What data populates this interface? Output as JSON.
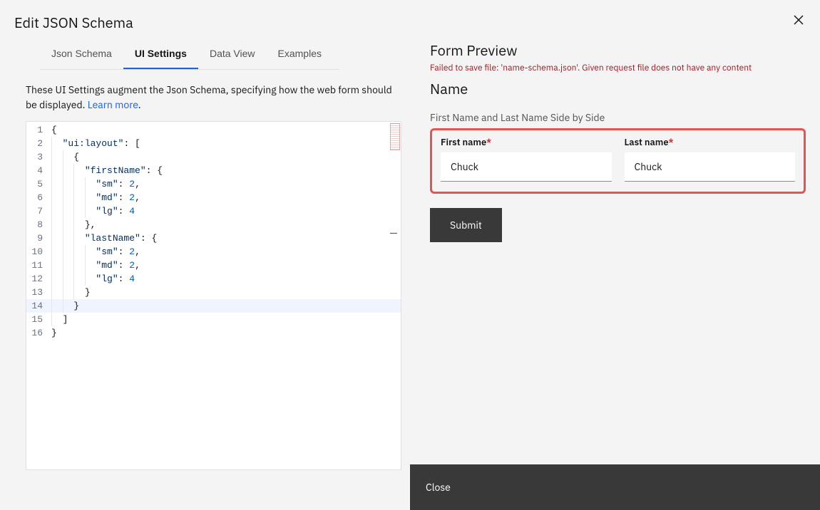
{
  "modal": {
    "title": "Edit JSON Schema",
    "close_bar_label": "Close"
  },
  "tabs": [
    {
      "label": "Json Schema",
      "active": false
    },
    {
      "label": "UI Settings",
      "active": true
    },
    {
      "label": "Data View",
      "active": false
    },
    {
      "label": "Examples",
      "active": false
    }
  ],
  "intro": {
    "text_before_link": "These UI Settings augment the Json Schema, specifying how the web form should be displayed. ",
    "link_text": "Learn more",
    "text_after_link": "."
  },
  "code_lines": [
    {
      "n": 1,
      "indent": 0,
      "tokens": [
        {
          "c": "brace",
          "t": "{"
        }
      ]
    },
    {
      "n": 2,
      "indent": 1,
      "tokens": [
        {
          "c": "key",
          "t": "\"ui:layout\""
        },
        {
          "c": "punct",
          "t": ": "
        },
        {
          "c": "bracket",
          "t": "["
        }
      ]
    },
    {
      "n": 3,
      "indent": 2,
      "tokens": [
        {
          "c": "brace",
          "t": "{"
        }
      ]
    },
    {
      "n": 4,
      "indent": 3,
      "tokens": [
        {
          "c": "key",
          "t": "\"firstName\""
        },
        {
          "c": "punct",
          "t": ": "
        },
        {
          "c": "brace",
          "t": "{"
        }
      ]
    },
    {
      "n": 5,
      "indent": 4,
      "tokens": [
        {
          "c": "key",
          "t": "\"sm\""
        },
        {
          "c": "punct",
          "t": ": "
        },
        {
          "c": "num",
          "t": "2"
        },
        {
          "c": "punct",
          "t": ","
        }
      ]
    },
    {
      "n": 6,
      "indent": 4,
      "tokens": [
        {
          "c": "key",
          "t": "\"md\""
        },
        {
          "c": "punct",
          "t": ": "
        },
        {
          "c": "num",
          "t": "2"
        },
        {
          "c": "punct",
          "t": ","
        }
      ]
    },
    {
      "n": 7,
      "indent": 4,
      "tokens": [
        {
          "c": "key",
          "t": "\"lg\""
        },
        {
          "c": "punct",
          "t": ": "
        },
        {
          "c": "num",
          "t": "4"
        }
      ]
    },
    {
      "n": 8,
      "indent": 3,
      "tokens": [
        {
          "c": "brace",
          "t": "}"
        },
        {
          "c": "punct",
          "t": ","
        }
      ]
    },
    {
      "n": 9,
      "indent": 3,
      "tokens": [
        {
          "c": "key",
          "t": "\"lastName\""
        },
        {
          "c": "punct",
          "t": ": "
        },
        {
          "c": "brace",
          "t": "{"
        }
      ]
    },
    {
      "n": 10,
      "indent": 4,
      "tokens": [
        {
          "c": "key",
          "t": "\"sm\""
        },
        {
          "c": "punct",
          "t": ": "
        },
        {
          "c": "num",
          "t": "2"
        },
        {
          "c": "punct",
          "t": ","
        }
      ]
    },
    {
      "n": 11,
      "indent": 4,
      "tokens": [
        {
          "c": "key",
          "t": "\"md\""
        },
        {
          "c": "punct",
          "t": ": "
        },
        {
          "c": "num",
          "t": "2"
        },
        {
          "c": "punct",
          "t": ","
        }
      ]
    },
    {
      "n": 12,
      "indent": 4,
      "tokens": [
        {
          "c": "key",
          "t": "\"lg\""
        },
        {
          "c": "punct",
          "t": ": "
        },
        {
          "c": "num",
          "t": "4"
        }
      ]
    },
    {
      "n": 13,
      "indent": 3,
      "tokens": [
        {
          "c": "brace",
          "t": "}"
        }
      ]
    },
    {
      "n": 14,
      "indent": 2,
      "tokens": [
        {
          "c": "brace",
          "t": "}"
        }
      ],
      "highlight": true
    },
    {
      "n": 15,
      "indent": 1,
      "tokens": [
        {
          "c": "bracket",
          "t": "]"
        }
      ]
    },
    {
      "n": 16,
      "indent": 0,
      "tokens": [
        {
          "c": "brace",
          "t": "}"
        }
      ]
    }
  ],
  "preview": {
    "heading": "Form Preview",
    "error": "Failed to save file: 'name-schema.json'. Given request file does not have any content",
    "form_title": "Name",
    "form_subtitle": "First Name and Last Name Side by Side",
    "fields": {
      "first_name": {
        "label": "First name",
        "required": true,
        "value": "Chuck"
      },
      "last_name": {
        "label": "Last name",
        "required": true,
        "value": "Chuck"
      }
    },
    "submit_label": "Submit"
  }
}
